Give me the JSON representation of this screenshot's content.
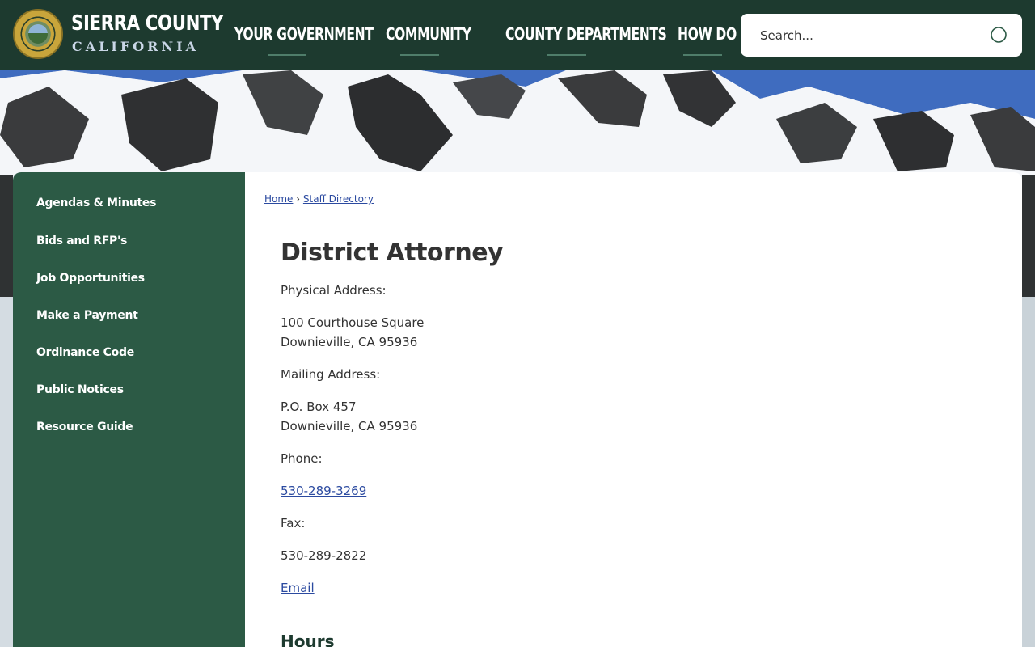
{
  "header": {
    "brand_top": "SIERRA COUNTY",
    "brand_bottom": "CALIFORNIA",
    "seal_text": "SIERRA COUNTY CALIFORNIA 1852"
  },
  "nav": {
    "items": [
      {
        "label": "YOUR GOVERNMENT"
      },
      {
        "label": "COMMUNITY"
      },
      {
        "label": "COUNTY DEPARTMENTS"
      },
      {
        "label": "HOW DO I"
      }
    ]
  },
  "search": {
    "placeholder": "Search...",
    "value": ""
  },
  "sidebar": {
    "items": [
      {
        "label": "Agendas & Minutes"
      },
      {
        "label": "Bids and RFP's"
      },
      {
        "label": "Job Opportunities"
      },
      {
        "label": "Make a Payment"
      },
      {
        "label": "Ordinance Code"
      },
      {
        "label": "Public Notices"
      },
      {
        "label": "Resource Guide"
      }
    ]
  },
  "breadcrumb": {
    "home": "Home",
    "separator": "›",
    "current": "Staff Directory"
  },
  "page": {
    "title": "District Attorney",
    "physical_label": "Physical Address:",
    "physical_line1": "100 Courthouse Square",
    "physical_line2": "Downieville, CA 95936",
    "mailing_label": "Mailing Address:",
    "mailing_line1": "P.O. Box 457",
    "mailing_line2": "Downieville, CA 95936",
    "phone_label": "Phone:",
    "phone": "530-289-3269",
    "fax_label": "Fax:",
    "fax": "530-289-2822",
    "email_link": "Email",
    "hours_heading": "Hours"
  },
  "colors": {
    "header_bg": "#1d3a2f",
    "sidebar_bg": "#2c5a45",
    "link": "#2b4aa0",
    "text": "#333333"
  }
}
